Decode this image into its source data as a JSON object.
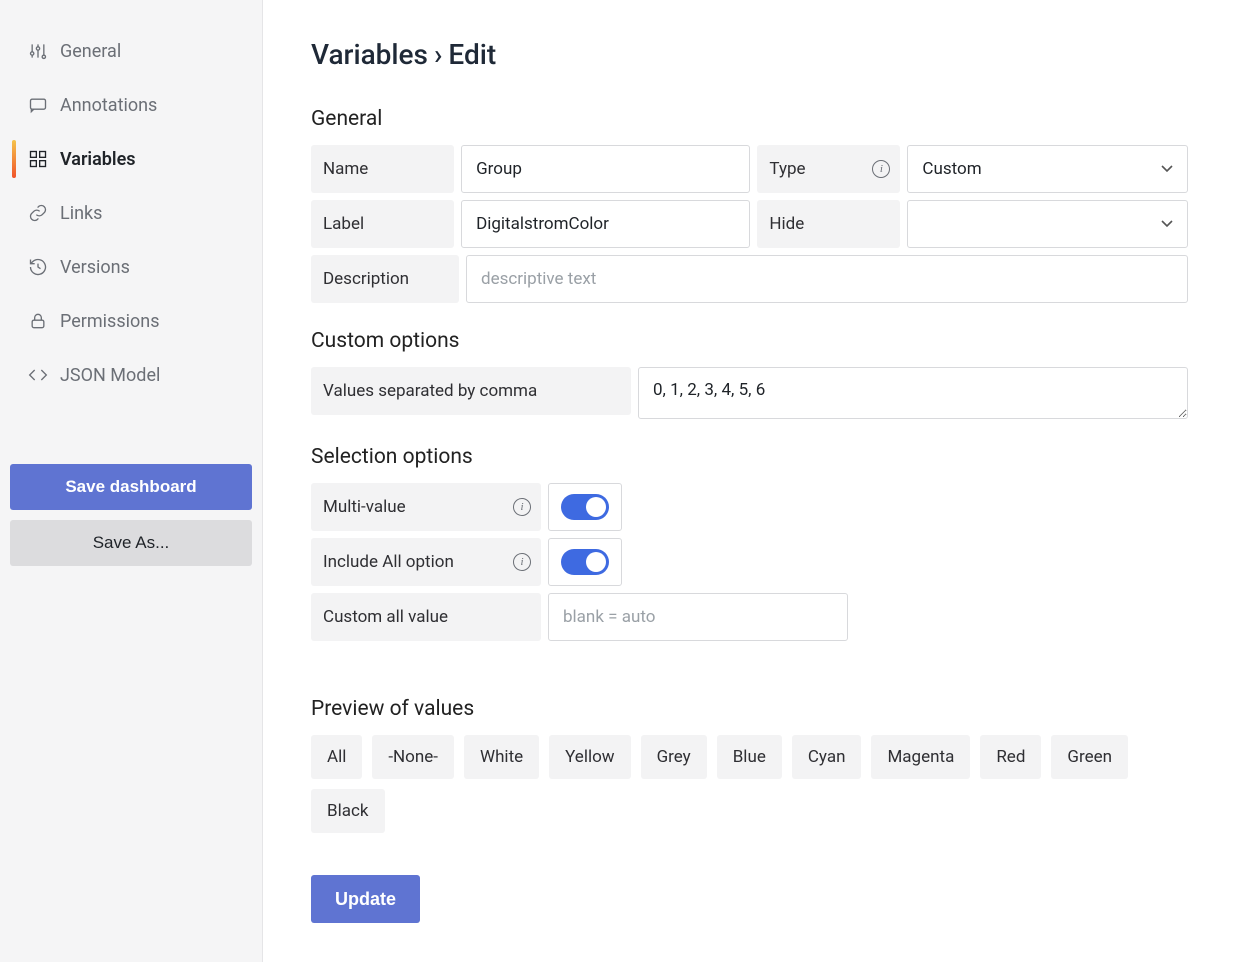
{
  "sidebar": {
    "items": [
      {
        "label": "General",
        "icon": "sliders"
      },
      {
        "label": "Annotations",
        "icon": "comment"
      },
      {
        "label": "Variables",
        "icon": "grid",
        "active": true
      },
      {
        "label": "Links",
        "icon": "link"
      },
      {
        "label": "Versions",
        "icon": "history"
      },
      {
        "label": "Permissions",
        "icon": "lock"
      },
      {
        "label": "JSON Model",
        "icon": "code"
      }
    ],
    "save_dashboard": "Save dashboard",
    "save_as": "Save As..."
  },
  "page": {
    "title_main": "Variables",
    "title_sub": "Edit"
  },
  "general": {
    "section": "General",
    "name_label": "Name",
    "name_value": "Group",
    "type_label": "Type",
    "type_value": "Custom",
    "label_label": "Label",
    "label_value": "DigitalstromColor",
    "hide_label": "Hide",
    "hide_value": "",
    "description_label": "Description",
    "description_placeholder": "descriptive text",
    "description_value": ""
  },
  "custom_options": {
    "section": "Custom options",
    "values_label": "Values separated by comma",
    "values_value": "0, 1, 2, 3, 4, 5, 6"
  },
  "selection_options": {
    "section": "Selection options",
    "multi_value_label": "Multi-value",
    "multi_value_enabled": true,
    "include_all_label": "Include All option",
    "include_all_enabled": true,
    "custom_all_label": "Custom all value",
    "custom_all_placeholder": "blank = auto",
    "custom_all_value": ""
  },
  "preview": {
    "section": "Preview of values",
    "values": [
      "All",
      "-None-",
      "White",
      "Yellow",
      "Grey",
      "Blue",
      "Cyan",
      "Magenta",
      "Red",
      "Green",
      "Black"
    ]
  },
  "update_label": "Update"
}
